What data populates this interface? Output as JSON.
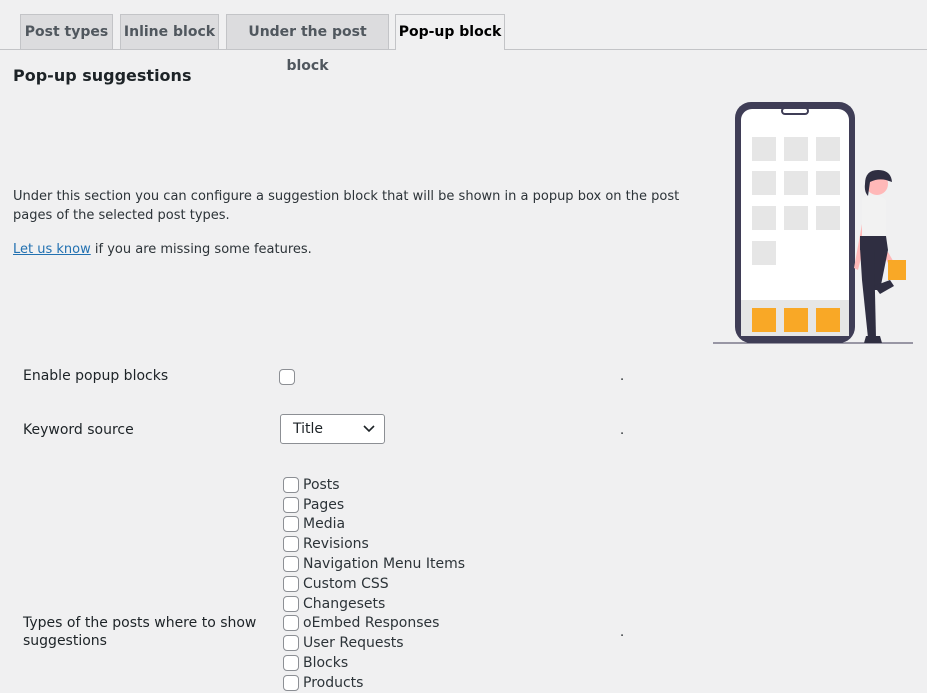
{
  "tabs": [
    {
      "label": "Post types"
    },
    {
      "label": "Inline block"
    },
    {
      "label": "Under the post block"
    },
    {
      "label": "Pop-up block"
    }
  ],
  "section": {
    "title": "Pop-up suggestions",
    "description": "Under this section you can configure a suggestion block that will be shown in a popup box on the post pages of the selected post types.",
    "link_text": "Let us know",
    "link_suffix": " if you are missing some features."
  },
  "illustration": {
    "icon": "phone-with-person-illustration",
    "accent": "#f9a826"
  },
  "settings": {
    "enable": {
      "label": "Enable popup blocks",
      "checked": false,
      "dot": "."
    },
    "keyword_source": {
      "label": "Keyword source",
      "value": "Title",
      "dot": "."
    },
    "post_types": {
      "label": "Types of the posts where to show suggestions",
      "dot": ".",
      "options": [
        "Posts",
        "Pages",
        "Media",
        "Revisions",
        "Navigation Menu Items",
        "Custom CSS",
        "Changesets",
        "oEmbed Responses",
        "User Requests",
        "Blocks",
        "Products"
      ]
    }
  }
}
